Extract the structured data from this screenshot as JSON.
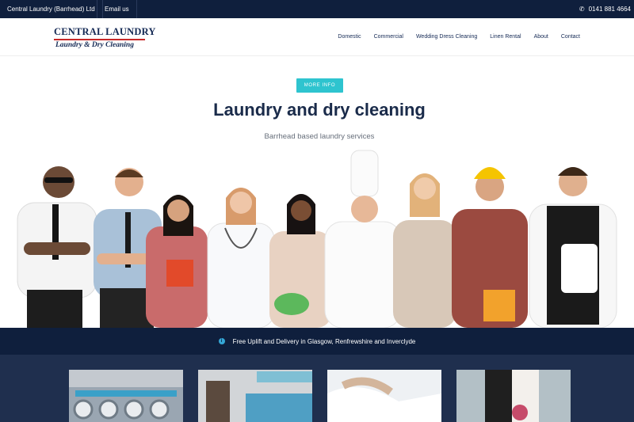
{
  "topbar": {
    "company": "Central Laundry (Barrhead) Ltd",
    "email_label": "Email us",
    "phone": "0141 881 4664"
  },
  "logo": {
    "top": "CENTRAL LAUNDRY",
    "bottom": "Laundry & Dry Cleaning"
  },
  "nav": {
    "items": [
      "Domestic",
      "Commercial",
      "Wedding Dress Cleaning",
      "Linen Rental",
      "About",
      "Contact"
    ]
  },
  "hero": {
    "button": "MORE INFO",
    "title": "Laundry and dry cleaning",
    "subtitle": "Barrhead based laundry services"
  },
  "notice": {
    "text": "Free Uplift and Delivery in Glasgow, Renfrewshire and Inverclyde"
  },
  "colors": {
    "navy": "#0f1f3d",
    "accent": "#2ec4cf",
    "logo_red": "#c62828",
    "heading": "#1a2b4a",
    "services_bg": "#1f2f4e"
  },
  "icons": [
    "phone-icon",
    "info-icon"
  ]
}
